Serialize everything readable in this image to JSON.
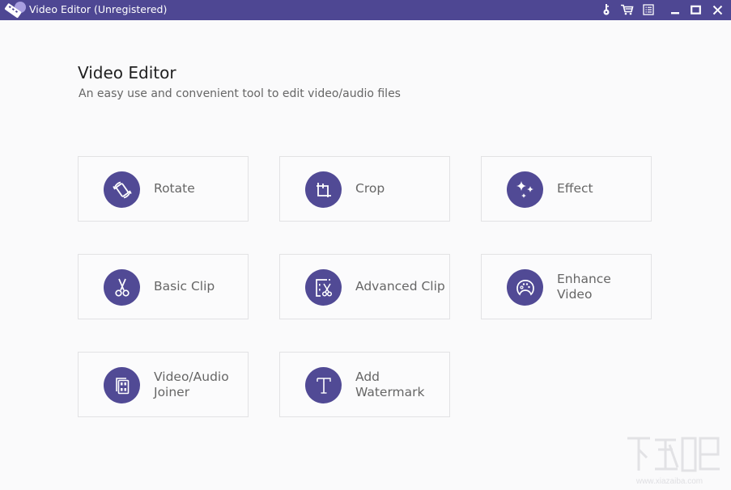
{
  "window": {
    "title": "Video Editor (Unregistered)",
    "accent_color": "#4e4793",
    "buttons": [
      {
        "name": "register",
        "icon": "key-icon"
      },
      {
        "name": "buy",
        "icon": "cart-icon"
      },
      {
        "name": "menu",
        "icon": "menu-list-icon"
      },
      {
        "name": "minimize",
        "icon": "minimize-icon"
      },
      {
        "name": "maximize",
        "icon": "maximize-icon"
      },
      {
        "name": "close",
        "icon": "close-icon"
      }
    ]
  },
  "header": {
    "title": "Video Editor",
    "subtitle": "An easy use and convenient tool to edit video/audio files"
  },
  "tools": [
    {
      "id": "rotate",
      "label_line1": "Rotate",
      "label_line2": "",
      "icon": "rotate-icon"
    },
    {
      "id": "crop",
      "label_line1": "Crop",
      "label_line2": "",
      "icon": "crop-icon"
    },
    {
      "id": "effect",
      "label_line1": "Effect",
      "label_line2": "",
      "icon": "sparkle-icon"
    },
    {
      "id": "basic-clip",
      "label_line1": "Basic Clip",
      "label_line2": "",
      "icon": "scissors-icon"
    },
    {
      "id": "advanced-clip",
      "label_line1": "Advanced Clip",
      "label_line2": "",
      "icon": "advanced-clip-icon"
    },
    {
      "id": "enhance-video",
      "label_line1": "Enhance",
      "label_line2": "Video",
      "icon": "palette-icon"
    },
    {
      "id": "video-audio-joiner",
      "label_line1": "Video/Audio",
      "label_line2": "Joiner",
      "icon": "film-joiner-icon"
    },
    {
      "id": "add-watermark",
      "label_line1": "Add",
      "label_line2": "Watermark",
      "icon": "text-t-icon"
    }
  ],
  "watermark": {
    "text": "www.xiazaiba.com"
  }
}
